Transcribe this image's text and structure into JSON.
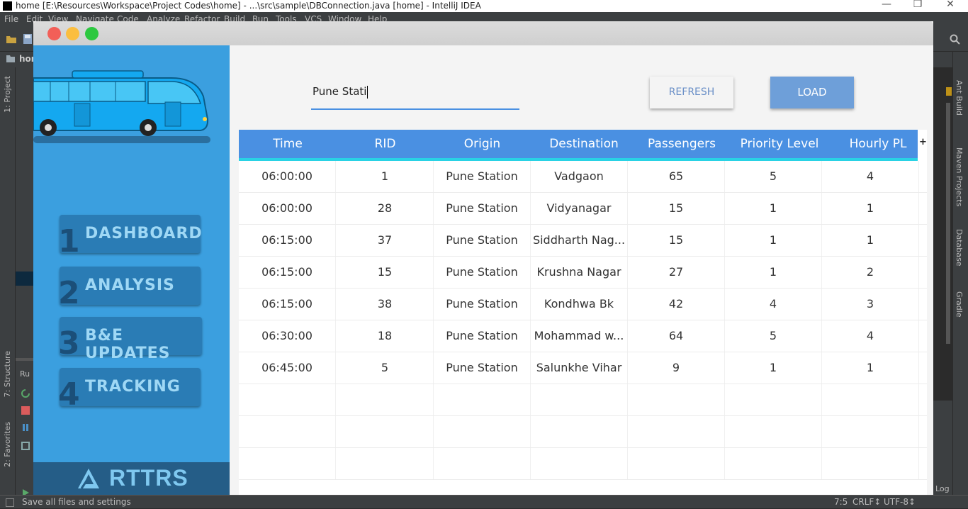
{
  "ide": {
    "window_title": "home [E:\\Resources\\Workspace\\Project Codes\\home] - ...\\src\\sample\\DBConnection.java [home] - IntelliJ IDEA",
    "menu": [
      "File",
      "Edit",
      "View",
      "Navigate",
      "Code",
      "Analyze",
      "Refactor",
      "Build",
      "Run",
      "Tools",
      "VCS",
      "Window",
      "Help"
    ],
    "nav_crumb": "hom",
    "left_tabs": [
      "1: Project",
      "7: Structure",
      "2: Favorites"
    ],
    "run_label": "Ru",
    "right_tabs": [
      "Ant Build",
      "Maven Projects",
      "Database",
      "Gradle"
    ],
    "status_message": "Save all files and settings",
    "status_position": "7:5",
    "status_line_sep": "CRLF↕",
    "status_encoding": "UTF-8↕",
    "event_log": "Log"
  },
  "app": {
    "sidebar": {
      "menu": [
        {
          "num": "1",
          "label": "DASHBOARD"
        },
        {
          "num": "2",
          "label": "ANALYSIS"
        },
        {
          "num": "3",
          "label": "B&E UPDATES"
        },
        {
          "num": "4",
          "label": "TRACKING"
        }
      ],
      "brand": "RTTRS"
    },
    "search": {
      "value": "Pune Stati"
    },
    "refresh_label": "REFRESH",
    "load_label": "LOAD",
    "table": {
      "columns": [
        "Time",
        "RID",
        "Origin",
        "Destination",
        "Passengers",
        "Priority Level",
        "Hourly PL"
      ],
      "add_column_label": "+",
      "rows": [
        [
          "06:00:00",
          "1",
          "Pune Station",
          "Vadgaon",
          "65",
          "5",
          "4"
        ],
        [
          "06:00:00",
          "28",
          "Pune Station",
          "Vidyanagar",
          "15",
          "1",
          "1"
        ],
        [
          "06:15:00",
          "37",
          "Pune Station",
          "Siddharth Nag...",
          "15",
          "1",
          "1"
        ],
        [
          "06:15:00",
          "15",
          "Pune Station",
          "Krushna Nagar",
          "27",
          "1",
          "2"
        ],
        [
          "06:15:00",
          "38",
          "Pune Station",
          "Kondhwa Bk",
          "42",
          "4",
          "3"
        ],
        [
          "06:30:00",
          "18",
          "Pune Station",
          "Mohammad w...",
          "64",
          "5",
          "4"
        ],
        [
          "06:45:00",
          "5",
          "Pune Station",
          "Salunkhe Vihar",
          "9",
          "1",
          "1"
        ]
      ]
    }
  }
}
